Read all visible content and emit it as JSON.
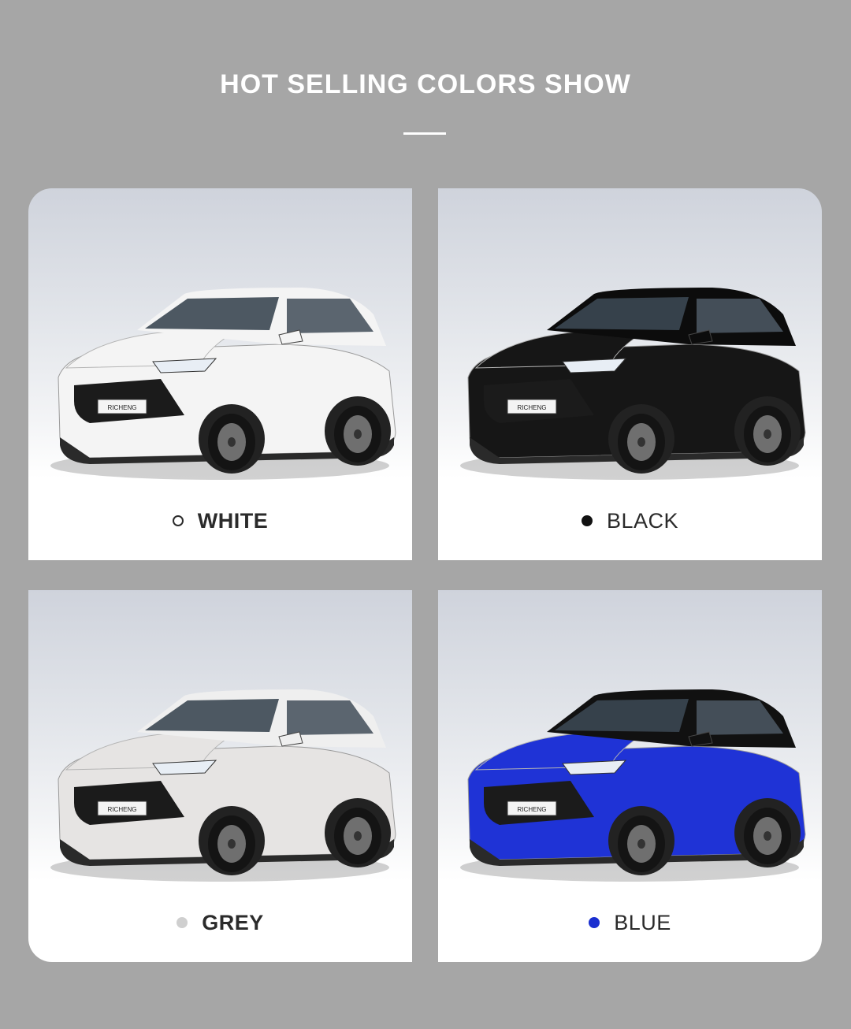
{
  "page": {
    "title": "HOT SELLING COLORS SHOW",
    "background": "#a6a6a6"
  },
  "cards": [
    {
      "label": "WHITE",
      "swatch_color": "#ffffff",
      "swatch_style": "outline",
      "body_color": "#f4f4f4",
      "roof_color": "#f4f4f4",
      "plate_text": "RICHENG"
    },
    {
      "label": "BLACK",
      "swatch_color": "#111111",
      "swatch_style": "filled",
      "body_color": "#161616",
      "roof_color": "#0c0c0c",
      "plate_text": "RICHENG"
    },
    {
      "label": "GREY",
      "swatch_color": "#cfcfcf",
      "swatch_style": "filled",
      "body_color": "#e6e4e3",
      "roof_color": "#efefef",
      "plate_text": "RICHENG"
    },
    {
      "label": "BLUE",
      "swatch_color": "#1a2fd0",
      "swatch_style": "filled",
      "body_color": "#1f33d6",
      "roof_color": "#111111",
      "plate_text": "RICHENG"
    }
  ]
}
